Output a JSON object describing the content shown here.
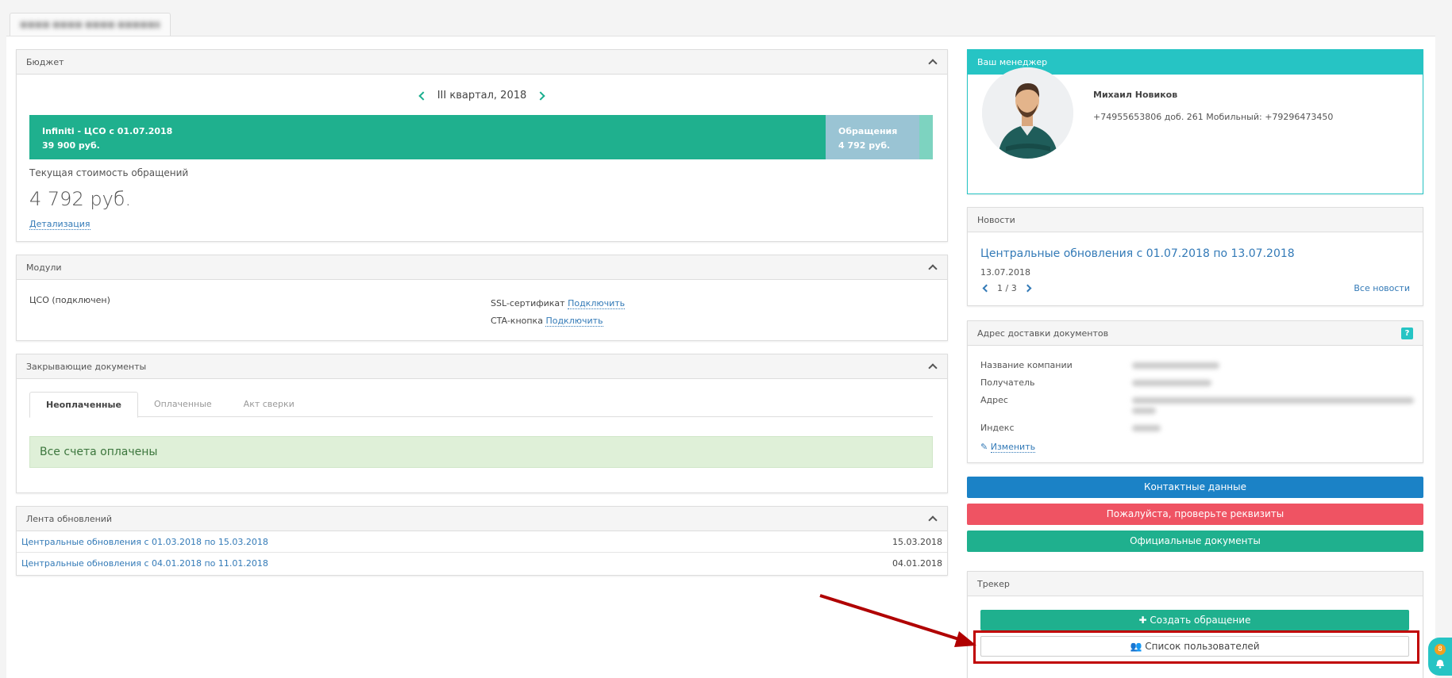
{
  "top_tab": {
    "label": "■■■■ ■■■■ ■■■■ ■■■■■■"
  },
  "budget": {
    "title": "Бюджет",
    "quarter": "III квартал, 2018",
    "bar_main_line1": "Infiniti - ЦСО с 01.07.2018",
    "bar_main_line2": "39 900 руб.",
    "bar_mid_line1": "Обращения",
    "bar_mid_line2": "4 792 руб.",
    "cost_label": "Текущая стоимость обращений",
    "cost_value": "4 792 руб.",
    "detail_link": "Детализация"
  },
  "modules": {
    "title": "Модули",
    "left_item": "ЦСО (подключен)",
    "ssl_label": "SSL-сертификат",
    "ssl_link": "Подключить",
    "cta_label": "CTA-кнопка",
    "cta_link": "Подключить"
  },
  "docs": {
    "title": "Закрывающие документы",
    "tabs": [
      "Неоплаченные",
      "Оплаченные",
      "Акт сверки"
    ],
    "alert": "Все счета оплачены"
  },
  "feed": {
    "title": "Лента обновлений",
    "rows": [
      {
        "text": "Центральные обновления с 01.03.2018 по 15.03.2018",
        "date": "15.03.2018"
      },
      {
        "text": "Центральные обновления с 04.01.2018 по 11.01.2018",
        "date": "04.01.2018"
      }
    ]
  },
  "manager": {
    "title": "Ваш менеджер",
    "name": "Михаил Новиков",
    "phone": "+74955653806 доб. 261 Мобильный: +79296473450"
  },
  "news": {
    "title": "Новости",
    "headline": "Центральные обновления с 01.07.2018 по 13.07.2018",
    "date": "13.07.2018",
    "pager": "1 / 3",
    "all_link": "Все новости"
  },
  "address": {
    "title": "Адрес доставки документов",
    "help": "?",
    "labels": [
      "Название компании",
      "Получатель",
      "Адрес",
      "Индекс"
    ],
    "edit_link": "Изменить"
  },
  "buttons": {
    "contacts": "Контактные данные",
    "check_details": "Пожалуйста, проверьте реквизиты",
    "official_docs": "Официальные документы"
  },
  "tracker": {
    "title": "Трекер",
    "create": "Создать обращение",
    "users": "Список пользователей"
  },
  "notifications": {
    "count": "8"
  },
  "colors": {
    "teal": "#26c4c4",
    "green": "#1fb08e",
    "blue": "#1b82c6",
    "red": "#ef5363",
    "annotation": "#c00000"
  }
}
